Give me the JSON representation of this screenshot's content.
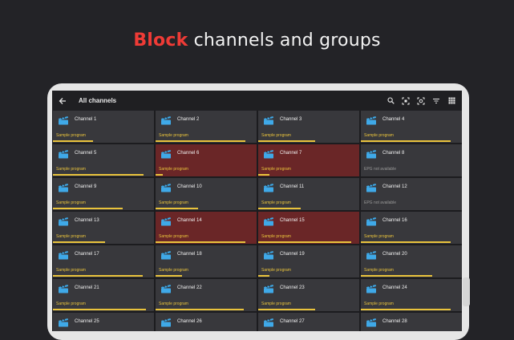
{
  "headline": {
    "accent": "Block",
    "rest": " channels and groups"
  },
  "appbar": {
    "title": "All channels",
    "actions": [
      "search-icon",
      "scan-icon",
      "screenshot-icon",
      "filter-icon",
      "grid-view-icon"
    ]
  },
  "colors": {
    "accent": "#ef3b36",
    "blocked_tile": "#6a2627",
    "tile": "#38383c",
    "progress": "#e9c33c"
  },
  "channels": [
    {
      "name": "Channel 1",
      "program": "Sample program",
      "progress": 0.42,
      "blocked": false
    },
    {
      "name": "Channel 2",
      "program": "Sample program",
      "progress": 0.95,
      "blocked": false
    },
    {
      "name": "Channel 3",
      "program": "Sample program",
      "progress": 0.6,
      "blocked": false
    },
    {
      "name": "Channel 4",
      "program": "Sample program",
      "progress": 0.95,
      "blocked": false
    },
    {
      "name": "Channel 5",
      "program": "Sample program",
      "progress": 0.96,
      "blocked": false
    },
    {
      "name": "Channel 6",
      "program": "Sample program",
      "progress": 0.08,
      "blocked": true
    },
    {
      "name": "Channel 7",
      "program": "Sample program",
      "progress": 0.12,
      "blocked": true
    },
    {
      "name": "Channel 8",
      "program": "EPG not available",
      "progress": 0,
      "blocked": false
    },
    {
      "name": "Channel 9",
      "program": "Sample program",
      "progress": 0.74,
      "blocked": false
    },
    {
      "name": "Channel 10",
      "program": "Sample program",
      "progress": 0.45,
      "blocked": false
    },
    {
      "name": "Channel 11",
      "program": "Sample program",
      "progress": 0.45,
      "blocked": false
    },
    {
      "name": "Channel 12",
      "program": "EPG not available",
      "progress": 0,
      "blocked": false
    },
    {
      "name": "Channel 13",
      "program": "Sample program",
      "progress": 0.55,
      "blocked": false
    },
    {
      "name": "Channel 14",
      "program": "Sample program",
      "progress": 0.95,
      "blocked": true
    },
    {
      "name": "Channel 15",
      "program": "Sample program",
      "progress": 0.98,
      "blocked": true
    },
    {
      "name": "Channel 16",
      "program": "Sample program",
      "progress": 0.95,
      "blocked": false
    },
    {
      "name": "Channel 17",
      "program": "Sample program",
      "progress": 0.95,
      "blocked": false
    },
    {
      "name": "Channel 18",
      "program": "Sample program",
      "progress": 0.28,
      "blocked": false
    },
    {
      "name": "Channel 19",
      "program": "Sample program",
      "progress": 0.12,
      "blocked": false
    },
    {
      "name": "Channel 20",
      "program": "Sample program",
      "progress": 0.75,
      "blocked": false
    },
    {
      "name": "Channel 21",
      "program": "Sample program",
      "progress": 0.98,
      "blocked": false
    },
    {
      "name": "Channel 22",
      "program": "Sample program",
      "progress": 0.93,
      "blocked": false
    },
    {
      "name": "Channel 23",
      "program": "Sample program",
      "progress": 0.6,
      "blocked": false
    },
    {
      "name": "Channel 24",
      "program": "Sample program",
      "progress": 0.95,
      "blocked": false
    },
    {
      "name": "Channel 25",
      "program": "",
      "progress": 0,
      "blocked": false
    },
    {
      "name": "Channel 26",
      "program": "",
      "progress": 0,
      "blocked": false
    },
    {
      "name": "Channel 27",
      "program": "",
      "progress": 0,
      "blocked": false
    },
    {
      "name": "Channel 28",
      "program": "",
      "progress": 0,
      "blocked": false
    }
  ]
}
